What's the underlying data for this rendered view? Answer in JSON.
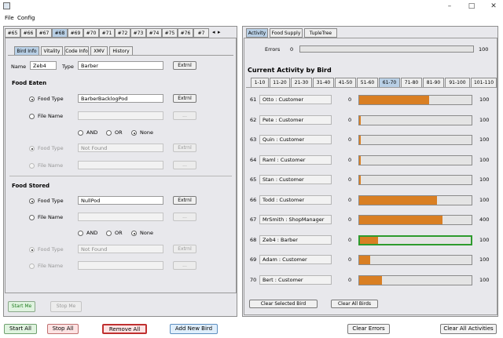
{
  "menu": [
    "File",
    "Config"
  ],
  "left": {
    "bird_tabs": [
      "#65",
      "#66",
      "#67",
      "#68",
      "#69",
      "#70",
      "#71",
      "#72",
      "#73",
      "#74",
      "#75",
      "#76",
      "#7"
    ],
    "selected_bird_tab": "#68",
    "sub_tabs": [
      "Bird Info",
      "Vitality",
      "Code Info",
      "XMV",
      "History"
    ],
    "selected_sub_tab": "Bird Info",
    "name_label": "Name",
    "name_value": "Zeb4",
    "type_label": "Type",
    "type_value": "Barber",
    "extrnl_label": "Extrnl",
    "browse_label": "...",
    "food_eaten": {
      "title": "Food Eaten",
      "food_type_label": "Food Type",
      "food_type_value": "BarberBacklogPod",
      "file_name_label": "File Name",
      "and_label": "AND",
      "or_label": "OR",
      "none_label": "None",
      "food_type_label_2": "Food Type",
      "food_type_value_2": "Not Found",
      "file_name_label_2": "File Name"
    },
    "food_stored": {
      "title": "Food Stored",
      "food_type_label": "Food Type",
      "food_type_value": "NullPod",
      "file_name_label": "File Name",
      "and_label": "AND",
      "or_label": "OR",
      "none_label": "None",
      "food_type_label_2": "Food Type",
      "food_type_value_2": "Not Found",
      "file_name_label_2": "File Name"
    },
    "start_me": "Start Me",
    "stop_me": "Stop Me"
  },
  "right": {
    "tabs": [
      "Activity",
      "Food Supply",
      "TupleTree"
    ],
    "selected_tab": "Activity",
    "errors_label": "Errors",
    "errors_min": "0",
    "errors_max": "100",
    "title": "Current Activity by Bird",
    "range_tabs": [
      "1-10",
      "11-20",
      "21-30",
      "31-40",
      "41-50",
      "51-60",
      "61-70",
      "71-80",
      "81-90",
      "91-100",
      "101-110"
    ],
    "selected_range": "61-70",
    "rows": [
      {
        "num": "61",
        "name": "Otto : Customer",
        "min": "0",
        "max": "100",
        "level": 0.62,
        "highlight": false
      },
      {
        "num": "62",
        "name": "Pete : Customer",
        "min": "0",
        "max": "100",
        "level": 0.0,
        "highlight": false
      },
      {
        "num": "63",
        "name": "Quin : Customer",
        "min": "0",
        "max": "100",
        "level": 0.0,
        "highlight": false
      },
      {
        "num": "64",
        "name": "Raml : Customer",
        "min": "0",
        "max": "100",
        "level": 0.0,
        "highlight": false
      },
      {
        "num": "65",
        "name": "Stan : Customer",
        "min": "0",
        "max": "100",
        "level": 0.0,
        "highlight": false
      },
      {
        "num": "66",
        "name": "Todd : Customer",
        "min": "0",
        "max": "100",
        "level": 0.69,
        "highlight": false
      },
      {
        "num": "67",
        "name": "MrSmith : ShopManager",
        "min": "0",
        "max": "400",
        "level": 0.74,
        "highlight": false
      },
      {
        "num": "68",
        "name": "Zeb4 : Barber",
        "min": "0",
        "max": "100",
        "level": 0.16,
        "highlight": true
      },
      {
        "num": "69",
        "name": "Adam : Customer",
        "min": "0",
        "max": "100",
        "level": 0.1,
        "highlight": false
      },
      {
        "num": "70",
        "name": "Bert : Customer",
        "min": "0",
        "max": "100",
        "level": 0.2,
        "highlight": false
      }
    ],
    "clear_selected": "Clear Selected Bird",
    "clear_all_birds": "Clear All Birds"
  },
  "bottom": {
    "start_all": "Start All",
    "stop_all": "Stop All",
    "remove_all": "Remove All",
    "add_new_bird": "Add New Bird",
    "clear_errors": "Clear Errors",
    "clear_all_activities": "Clear All Activities"
  },
  "colors": {
    "bar_fill": "#d97f23",
    "highlight_border": "#2e9b2e",
    "selected_tab": "#b8cfe5",
    "start_green": "#dff3df",
    "stop_red": "#fde3e3",
    "add_blue": "#dfeefb"
  }
}
